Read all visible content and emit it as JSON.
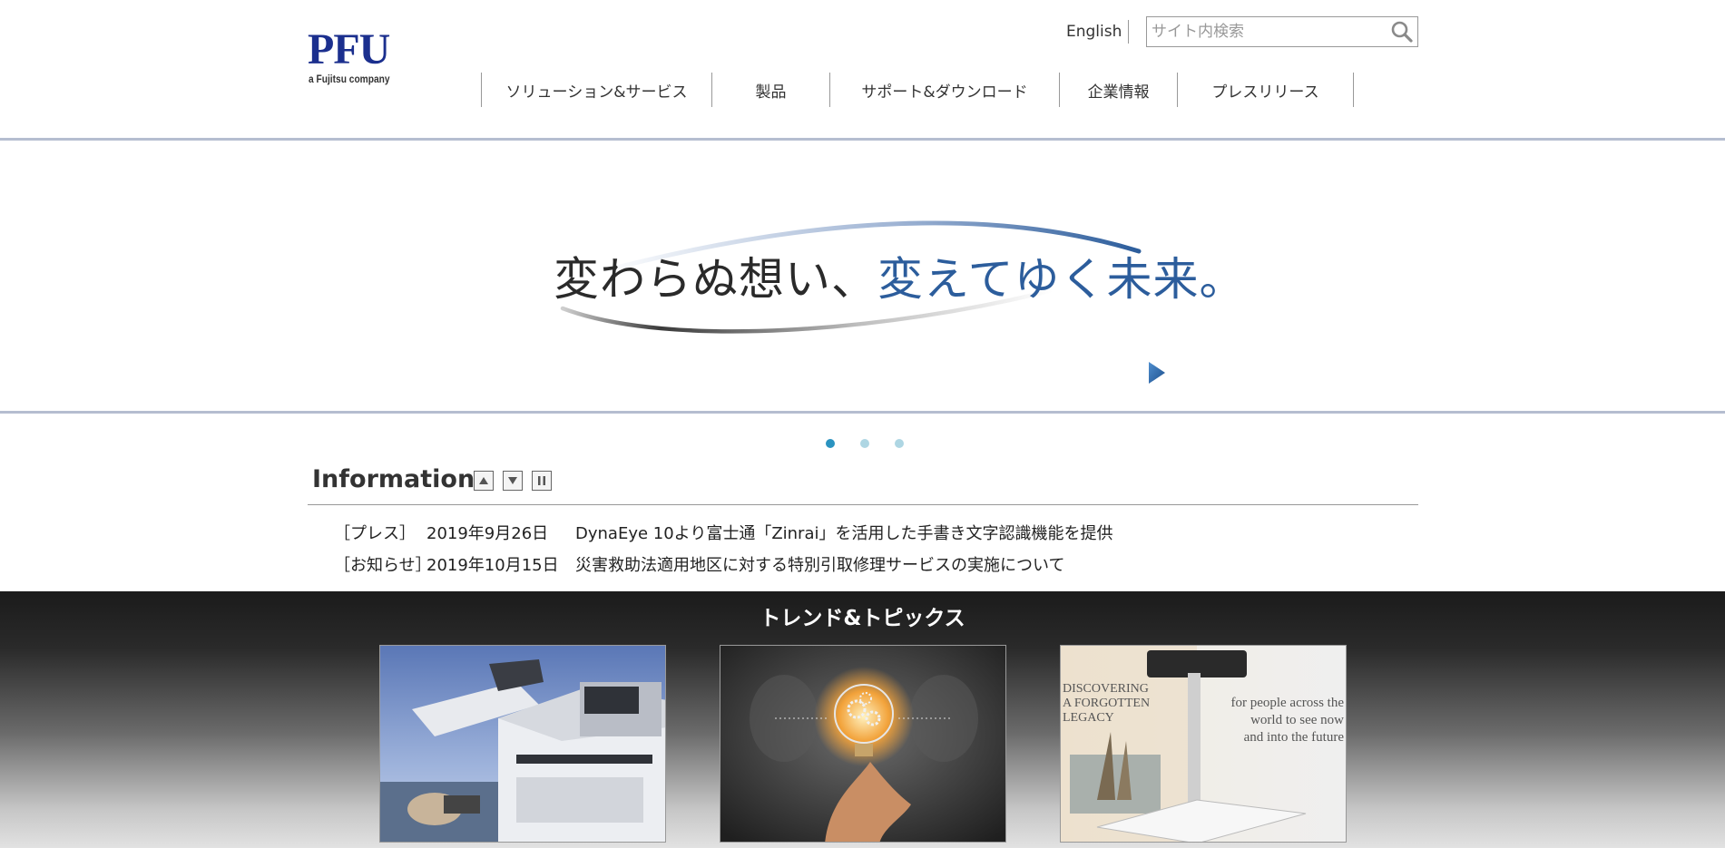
{
  "header": {
    "logo_text": "PFU",
    "logo_tagline": "a Fujitsu company",
    "english_link": "English",
    "search": {
      "placeholder": "サイト内検索"
    },
    "nav": [
      {
        "label": "ソリューション&サービス"
      },
      {
        "label": "製品"
      },
      {
        "label": "サポート&ダウンロード"
      },
      {
        "label": "企業情報"
      },
      {
        "label": "プレスリリース"
      }
    ]
  },
  "hero": {
    "slogan_part1": "変わらぬ想い、",
    "slogan_part2": "変えてゆく未来。",
    "slide_count": 3,
    "active_slide": 1
  },
  "information": {
    "title": "Information",
    "items": [
      {
        "category": "［プレス］",
        "date": "2019年9月26日",
        "text": "DynaEye 10より富士通「Zinrai」を活用した手書き文字認識機能を提供"
      },
      {
        "category": "［お知らせ］",
        "date": "2019年10月15日",
        "text": "災害救助法適用地区に対する特別引取修理サービスの実施について"
      }
    ]
  },
  "trends": {
    "title": "トレンド&トピックス",
    "cards": [
      {
        "name": "scanner"
      },
      {
        "name": "lightbulb"
      },
      {
        "name": "book-scanner",
        "text_left": [
          "DISCOVERING",
          "A FORGOTTEN",
          "LEGACY"
        ],
        "text_right": [
          "for people across the",
          "world to see now",
          "and into the future"
        ]
      }
    ]
  },
  "colors": {
    "brand": "#1b2f8e",
    "accent_blue": "#2c5d9c",
    "dot_active": "#2b93c0",
    "dot_inactive": "#aed6e3"
  }
}
